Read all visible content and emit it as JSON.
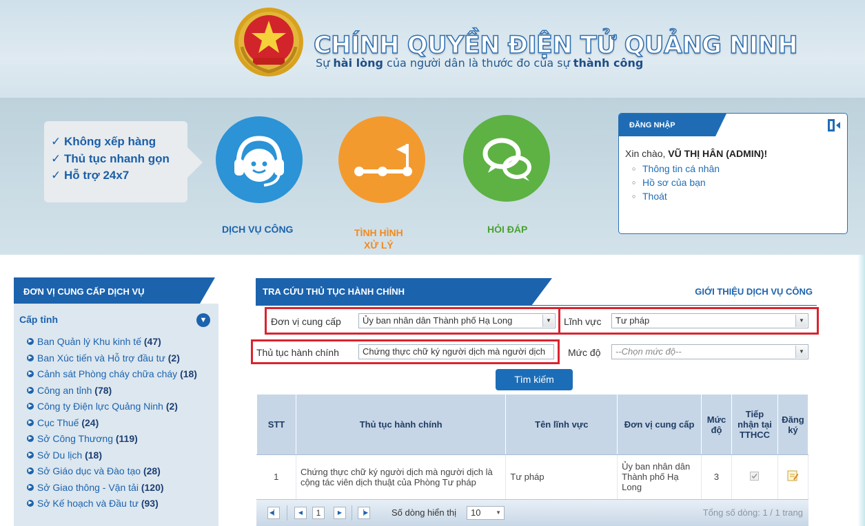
{
  "header": {
    "site_title": "CHÍNH QUYỀN ĐIỆN TỬ QUẢNG NINH",
    "slogan_parts": [
      "Sự ",
      "hài lòng",
      " của người dân là thước đo của sự ",
      "thành công"
    ]
  },
  "hero": {
    "features": [
      "✓ Không xếp hàng",
      "✓ Thủ tục nhanh gọn",
      "✓ Hỗ trợ 24x7"
    ],
    "services": [
      {
        "label": "DỊCH VỤ CÔNG",
        "icon": "headset-icon",
        "color": "#2b93d6",
        "label_color": "#1c63ad"
      },
      {
        "label_lines": [
          "TÌNH HÌNH",
          "XỬ LÝ"
        ],
        "icon": "progress-flag-icon",
        "color": "#f39a2f",
        "label_color": "#f08a1f"
      },
      {
        "label": "HỎI ĐÁP",
        "icon": "chat-bubbles-icon",
        "color": "#5db243",
        "label_color": "#4aa132"
      }
    ],
    "login": {
      "title": "ĐĂNG NHẬP",
      "greeting_prefix": "Xin chào, ",
      "user_name": "VŨ THỊ HÂN (ADMIN)",
      "greeting_suffix": "!",
      "links": [
        "Thông tin cá nhân",
        "Hồ sơ của bạn",
        "Thoát"
      ]
    }
  },
  "sidebar": {
    "title": "ĐƠN VỊ CUNG CẤP DỊCH VỤ",
    "group_label": "Cấp tỉnh",
    "items": [
      {
        "name": "Ban Quản lý Khu kinh tế",
        "count": "(47)"
      },
      {
        "name": "Ban Xúc tiến và Hỗ trợ đầu tư",
        "count": "(2)"
      },
      {
        "name": "Cảnh sát Phòng cháy chữa cháy",
        "count": "(18)"
      },
      {
        "name": "Công an tỉnh",
        "count": "(78)"
      },
      {
        "name": "Công ty Điện lực Quảng Ninh",
        "count": "(2)"
      },
      {
        "name": "Cục Thuế",
        "count": "(24)"
      },
      {
        "name": "Sở Công Thương",
        "count": "(119)"
      },
      {
        "name": "Sở Du lịch",
        "count": "(18)"
      },
      {
        "name": "Sở Giáo dục và Đào tạo",
        "count": "(28)"
      },
      {
        "name": "Sở Giao thông - Vận tải",
        "count": "(120)"
      },
      {
        "name": "Sở Kế hoạch và Đầu tư",
        "count": "(93)"
      }
    ]
  },
  "main": {
    "tab_title": "TRA CỨU THỦ TỤC HÀNH CHÍNH",
    "intro_link": "GIỚI THIỆU DỊCH VỤ CÔNG",
    "form": {
      "provider_label": "Đơn vị cung cấp",
      "provider_value": "Ủy ban nhân dân Thành phố  Hạ Long",
      "field_label": "Lĩnh vực",
      "field_value": "Tư pháp",
      "procedure_label": "Thủ tục hành chính",
      "procedure_value": "Chứng thực chữ ký người dịch mà người dịch",
      "level_label": "Mức độ",
      "level_placeholder": "--Chọn mức độ--",
      "search_button": "Tìm kiếm"
    },
    "table": {
      "headers": [
        "STT",
        "Thủ tục hành chính",
        "Tên lĩnh vực",
        "Đơn vị cung cấp",
        "Mức độ",
        "Tiếp nhận tại TTHCC",
        "Đăng ký"
      ],
      "rows": [
        {
          "stt": "1",
          "procedure": "Chứng thực chữ ký người dịch mà người dịch là cộng tác viên dịch thuật của Phòng Tư pháp",
          "field": "Tư pháp",
          "provider": "Ủy ban nhân dân Thành phố Hạ Long",
          "level": "3",
          "tthcc_checked": true,
          "register_icon": "edit-note-icon"
        }
      ]
    },
    "pager": {
      "current_page": "1",
      "rows_label": "Số dòng hiển thị",
      "rows_per_page": "10",
      "total_text": "Tổng số dòng: 1 / 1 trang"
    }
  },
  "colors": {
    "primary": "#1c63ad",
    "highlight_border": "#d9232e",
    "orange": "#f39a2f",
    "green": "#5db243"
  }
}
